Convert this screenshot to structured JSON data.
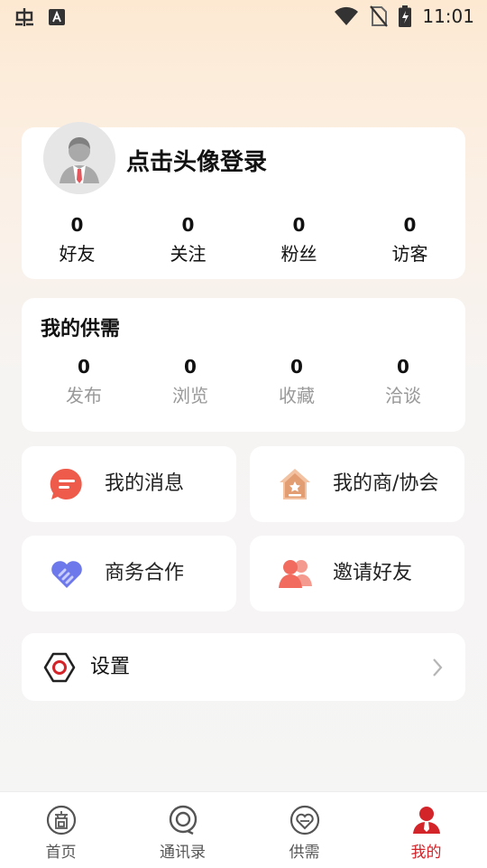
{
  "status_bar": {
    "time": "11:01",
    "icons": [
      "bug-icon",
      "accessibility-a-icon",
      "wifi-icon",
      "no-sim-icon",
      "battery-charging-icon"
    ]
  },
  "profile": {
    "login_prompt": "点击头像登录",
    "stats": [
      {
        "value": "0",
        "label": "好友"
      },
      {
        "value": "0",
        "label": "关注"
      },
      {
        "value": "0",
        "label": "粉丝"
      },
      {
        "value": "0",
        "label": "访客"
      }
    ]
  },
  "my_supply": {
    "title": "我的供需",
    "stats": [
      {
        "value": "0",
        "label": "发布"
      },
      {
        "value": "0",
        "label": "浏览"
      },
      {
        "value": "0",
        "label": "收藏"
      },
      {
        "value": "0",
        "label": "洽谈"
      }
    ]
  },
  "tiles": [
    {
      "label": "我的消息",
      "icon": "message-bubble-icon"
    },
    {
      "label": "我的商/协会",
      "icon": "association-house-icon"
    },
    {
      "label": "商务合作",
      "icon": "handshake-heart-icon"
    },
    {
      "label": "邀请好友",
      "icon": "invite-friends-icon"
    }
  ],
  "settings": {
    "label": "设置"
  },
  "tabbar": {
    "items": [
      {
        "label": "首页",
        "icon": "home-shang-icon"
      },
      {
        "label": "通讯录",
        "icon": "contacts-icon"
      },
      {
        "label": "供需",
        "icon": "supply-heart-icon"
      },
      {
        "label": "我的",
        "icon": "person-icon",
        "active": true
      }
    ]
  },
  "colors": {
    "accent": "#d3242a",
    "message": "#ef5b4a",
    "house": "#e8a87c",
    "handshake": "#6d78ea",
    "friends": "#f16b5e"
  }
}
